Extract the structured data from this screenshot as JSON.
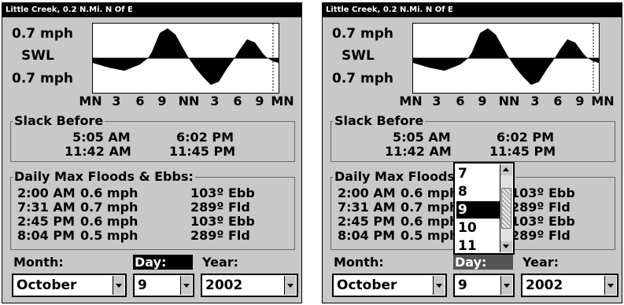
{
  "title": "Little Creek, 0.2 N.Mi. N Of E",
  "tide": {
    "top_label": "0.7 mph",
    "mid_label": "SWL",
    "bottom_label": "0.7 mph",
    "x_ticks": [
      "MN",
      "3",
      "6",
      "9",
      "NN",
      "3",
      "6",
      "9",
      "MN"
    ]
  },
  "slack": {
    "title": "Slack Before",
    "times": [
      "5:05 AM",
      "6:02 PM",
      "11:42 AM",
      "11:45 PM"
    ]
  },
  "floods": {
    "title": "Daily Max Floods & Ebbs:",
    "rows": [
      {
        "time": "2:00 AM",
        "speed": "0.6 mph",
        "dir": "103º Ebb"
      },
      {
        "time": "7:31 AM",
        "speed": "0.7 mph",
        "dir": "289º Fld"
      },
      {
        "time": "2:45 PM",
        "speed": "0.6 mph",
        "dir": "103º Ebb"
      },
      {
        "time": "8:04 PM",
        "speed": "0.5 mph",
        "dir": "289º Fld"
      }
    ]
  },
  "date": {
    "month_label": "Month:",
    "day_label": "Day:",
    "year_label": "Year:",
    "month": "October",
    "day": "9",
    "year": "2002"
  },
  "day_options": [
    "7",
    "8",
    "9",
    "10",
    "11"
  ],
  "selected_day": "9"
}
